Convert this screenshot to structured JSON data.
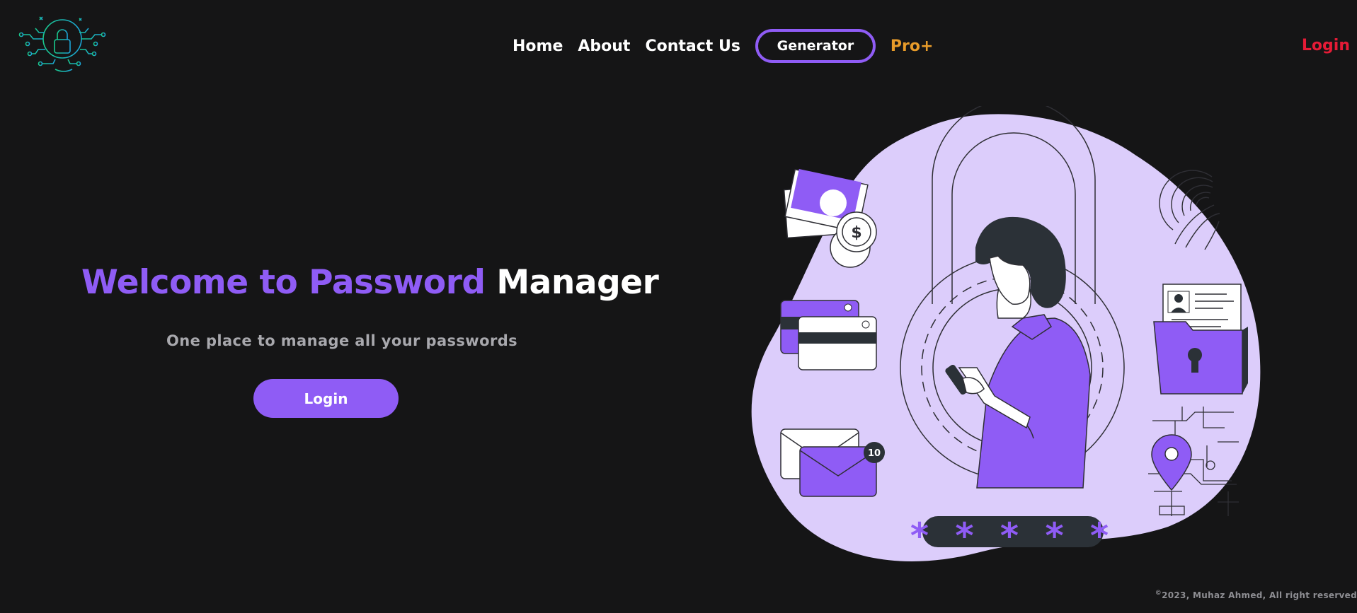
{
  "brand": {
    "logo_icon": "circuit-padlock-icon",
    "logo_color": "#1cc8a0"
  },
  "nav": {
    "home": "Home",
    "about": "About",
    "contact": "Contact Us",
    "generator": "Generator",
    "pro": "Pro+",
    "login": "Login"
  },
  "hero": {
    "title_accent": "Welcome to Password",
    "title_plain": "Manager",
    "subtitle": "One place to manage all your passwords",
    "button": "Login"
  },
  "illustration": {
    "badge_count": "10",
    "password_mask": "* * * * *",
    "icons": [
      "money-icon",
      "coin-icon",
      "credit-card-icon",
      "envelope-icon",
      "fingerprint-icon",
      "padlock-icon",
      "id-card-icon",
      "locked-folder-icon",
      "map-pin-icon",
      "woman-with-phone-figure"
    ]
  },
  "footer": {
    "copyright_symbol": "©",
    "text": "2023, Muhaz Ahmed, All right reserved"
  },
  "colors": {
    "background": "#151516",
    "accent_purple": "#8f5cf5",
    "light_purple": "#dccdfb",
    "pro_orange": "#e79b2a",
    "login_red": "#e51b36"
  }
}
